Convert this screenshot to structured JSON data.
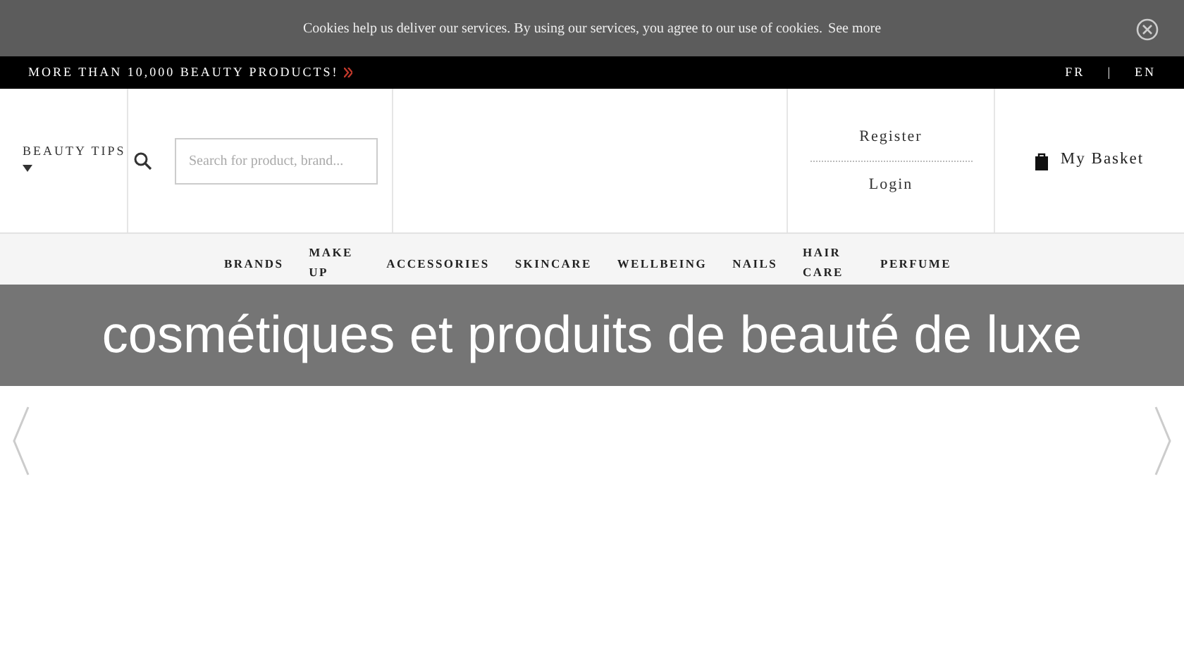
{
  "cookie_bar": {
    "text": "Cookies help us deliver our services. By using our services, you agree to our use of cookies.",
    "link": "See more"
  },
  "top_bar": {
    "promo": "MORE THAN 10,000 BEAUTY PRODUCTS!",
    "languages": [
      {
        "label": "FR",
        "selected": false
      },
      {
        "label": "EN",
        "selected": false
      }
    ],
    "separator": "|"
  },
  "header": {
    "beauty_tips": "BEAUTY TIPS",
    "search": {
      "placeholder": "Search for product, brand..."
    },
    "register": "Register",
    "login": "Login",
    "basket": "My Basket"
  },
  "nav": [
    {
      "label": "BRANDS"
    },
    {
      "label": "MAKE UP"
    },
    {
      "label": "ACCESSORIES"
    },
    {
      "label": "SKINCARE"
    },
    {
      "label": "WELLBEING"
    },
    {
      "label": "NAILS"
    },
    {
      "label": "HAIR CARE"
    },
    {
      "label": "PERFUME"
    }
  ],
  "title_overlay": "cosmétiques et produits de beauté de luxe"
}
